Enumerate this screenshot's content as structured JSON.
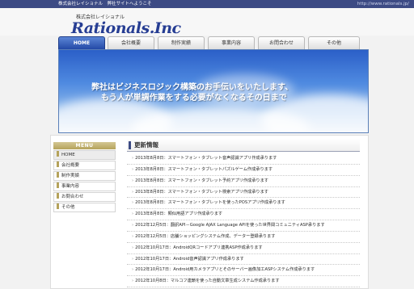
{
  "topbar": {
    "welcome": "株式会社レイショナル　弊社サイトへようこそ",
    "url": "http://www.rationals.jp/"
  },
  "header": {
    "company_jp": "株式会社レイショナル",
    "logo": "Rationals.Inc"
  },
  "nav": {
    "tabs": [
      {
        "label": "HOME",
        "active": true
      },
      {
        "label": "会社概要"
      },
      {
        "label": "制作実績"
      },
      {
        "label": "事業内容"
      },
      {
        "label": "お問合わせ"
      },
      {
        "label": "その他"
      }
    ]
  },
  "hero": {
    "line1": "弊社はビジネスロジック構築のお手伝いをいたします、",
    "line2": "もう人が単調作業をする必要がなくなるその日まで"
  },
  "sidebar": {
    "title": "MENU",
    "items": [
      {
        "label": "HOME",
        "active": true
      },
      {
        "label": "会社概要"
      },
      {
        "label": "制作実績"
      },
      {
        "label": "事業内容"
      },
      {
        "label": "お問合わせ"
      },
      {
        "label": "その他"
      }
    ]
  },
  "news": {
    "title": "更新情報",
    "items": [
      "2013年8月8日：スマートフォン・タブレット音声認識アプリ作成承ります",
      "2013年8月8日：スマートフォン・タブレットパズルゲーム作成承ります",
      "2013年8月8日：スマートフォン・タブレット予約アプリ作成承ります",
      "2013年8月8日：スマートフォン・タブレット検索アプリ作成承ります",
      "2013年8月8日：スマートフォン・タブレットを使ったPOSアプリ作成承ります",
      "2013年8月8日：類似用語アプリ作成承ります",
      "2012年12月5日：翻訳API－Google AJAX Language APIを使った世界間コミュニティASP承ります",
      "2012年12月5日：店舗ショッピングシステム作成、データー登録承ります",
      "2012年10月17日：AndroidQRコードアプリ連携ASP作成承ります",
      "2012年10月17日：Android音声認識アプリ作成承ります",
      "2012年10月17日：Android用カメラアプリとそのサーバー画像加工ASPシステム作成承ります",
      "2012年10月8日：マルコフ連鎖を使った自動文章生成システム作成承ります"
    ]
  }
}
